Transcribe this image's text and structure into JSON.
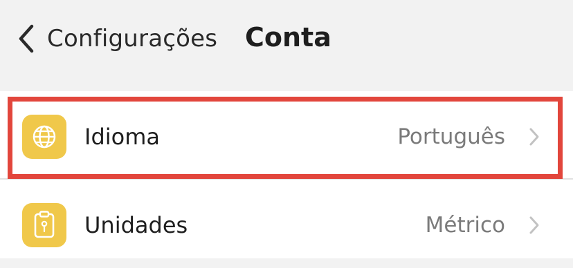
{
  "header": {
    "back_label": "Configurações",
    "title": "Conta",
    "back_icon": "chevron-left-icon"
  },
  "settings": {
    "items": [
      {
        "label": "Idioma",
        "value": "Português",
        "icon": "globe-icon",
        "highlighted": true
      },
      {
        "label": "Unidades",
        "value": "Métrico",
        "icon": "clipboard-icon",
        "highlighted": false
      }
    ]
  },
  "colors": {
    "icon_background": "#f0c84a",
    "highlight_border": "#e2463c",
    "page_background": "#f2f2f2",
    "list_background": "#ffffff"
  }
}
